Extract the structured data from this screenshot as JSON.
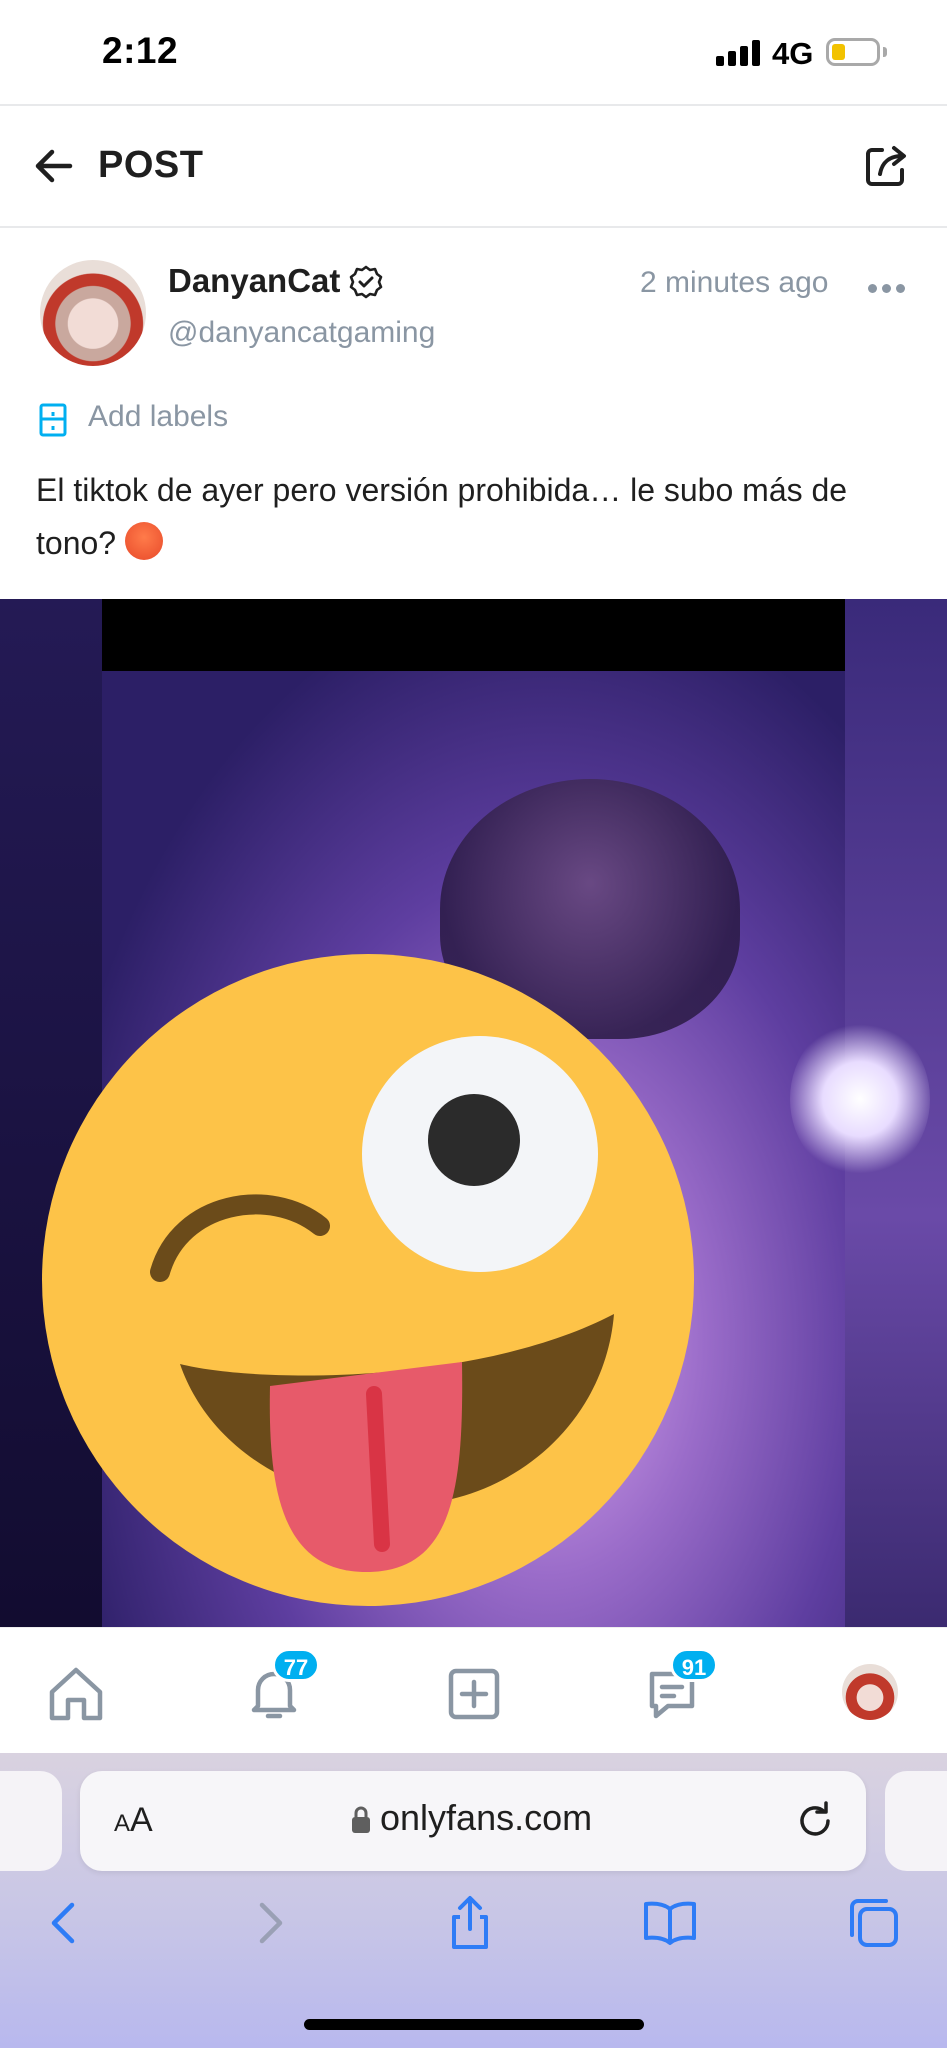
{
  "status_bar": {
    "time": "2:12",
    "network": "4G",
    "battery_level": 0.3
  },
  "header": {
    "title": "POST"
  },
  "post": {
    "author_name": "DanyanCat",
    "handle": "@danyancatgaming",
    "time_ago": "2 minutes ago",
    "labels_action": "Add labels",
    "text": "El tiktok de ayer pero versión prohibida… le subo más de tono?"
  },
  "tab_bar": {
    "notifications_count": "77",
    "messages_count": "91"
  },
  "browser": {
    "aa_small": "A",
    "aa_large": "A",
    "url": "onlyfans.com"
  },
  "colors": {
    "accent": "#00aff0",
    "muted": "#8a96a3",
    "ios_blue": "#2e7cf6",
    "text": "#1f1f1f"
  },
  "icons": [
    "back-arrow-icon",
    "share-icon",
    "verified-icon",
    "more-icon",
    "label-icon",
    "hot-face-emoji",
    "winking-tongue-emoji",
    "home-icon",
    "bell-icon",
    "add-post-icon",
    "messages-icon",
    "lock-icon",
    "reload-icon",
    "browser-back-icon",
    "browser-forward-icon",
    "browser-share-icon",
    "bookmarks-icon",
    "tabs-icon"
  ]
}
